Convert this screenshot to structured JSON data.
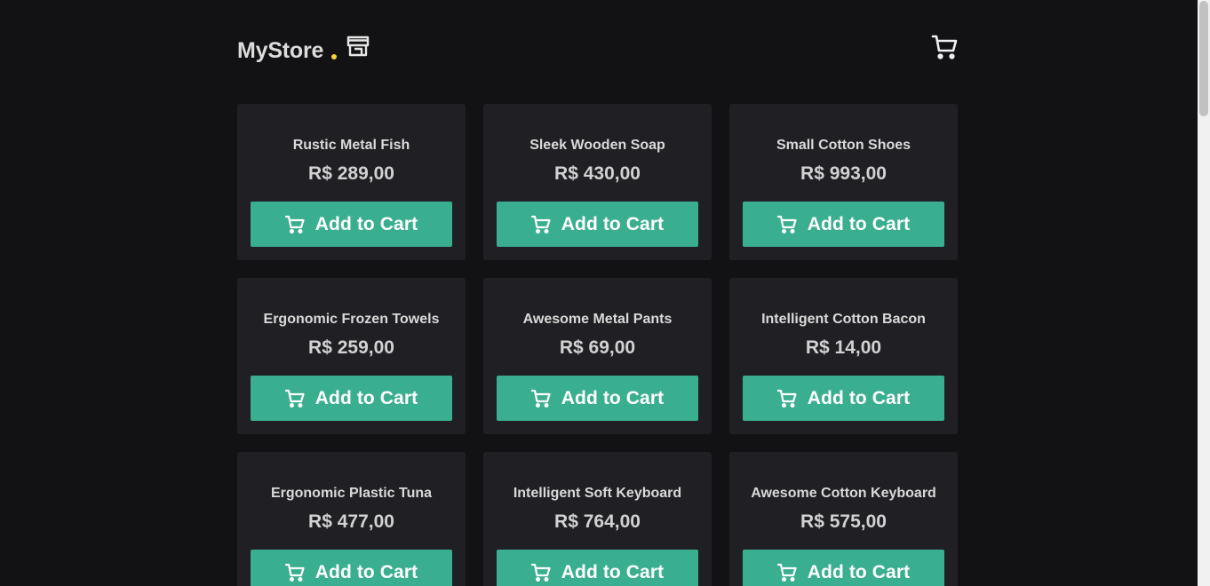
{
  "header": {
    "brand": "MyStore",
    "store_icon": "store-icon",
    "cart_icon": "cart-icon",
    "accent_color": "#fbd52d"
  },
  "products": [
    {
      "name": "Rustic Metal Fish",
      "price": "R$ 289,00",
      "button_label": "Add to Cart"
    },
    {
      "name": "Sleek Wooden Soap",
      "price": "R$ 430,00",
      "button_label": "Add to Cart"
    },
    {
      "name": "Small Cotton Shoes",
      "price": "R$ 993,00",
      "button_label": "Add to Cart"
    },
    {
      "name": "Ergonomic Frozen Towels",
      "price": "R$ 259,00",
      "button_label": "Add to Cart"
    },
    {
      "name": "Awesome Metal Pants",
      "price": "R$ 69,00",
      "button_label": "Add to Cart"
    },
    {
      "name": "Intelligent Cotton Bacon",
      "price": "R$ 14,00",
      "button_label": "Add to Cart"
    },
    {
      "name": "Ergonomic Plastic Tuna",
      "price": "R$ 477,00",
      "button_label": "Add to Cart"
    },
    {
      "name": "Intelligent Soft Keyboard",
      "price": "R$ 764,00",
      "button_label": "Add to Cart"
    },
    {
      "name": "Awesome Cotton Keyboard",
      "price": "R$ 575,00",
      "button_label": "Add to Cart"
    }
  ],
  "colors": {
    "background": "#121214",
    "card": "#202024",
    "button": "#3aaf8f"
  }
}
